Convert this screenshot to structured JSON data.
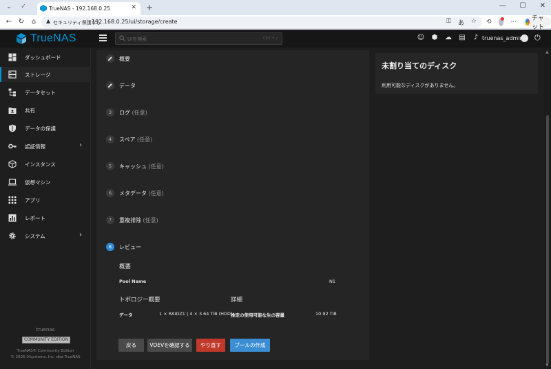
{
  "browser": {
    "tab_title": "TrueNAS - 192.168.0.25",
    "tab_close": "✕",
    "new_tab": "+",
    "security_label": "セキュリティ保護なし",
    "url": "192.168.0.25/ui/storage/create",
    "chat_label": "チャット",
    "controls": {
      "minimize": "—",
      "maximize": "☐",
      "close": "✕"
    }
  },
  "app": {
    "brand": "TrueNAS",
    "search_placeholder": "UIを検索",
    "search_shortcut": "Ctrl + /",
    "username": "truenas_admin"
  },
  "sidebar": {
    "items": [
      {
        "label": "ダッシュボード",
        "icon": "dashboard-icon"
      },
      {
        "label": "ストレージ",
        "icon": "storage-icon",
        "active": true
      },
      {
        "label": "データセット",
        "icon": "datasets-icon"
      },
      {
        "label": "共有",
        "icon": "shares-icon"
      },
      {
        "label": "データの保護",
        "icon": "shield-icon"
      },
      {
        "label": "認証情報",
        "icon": "key-icon",
        "chevron": "›"
      },
      {
        "label": "インスタンス",
        "icon": "cube-icon"
      },
      {
        "label": "仮想マシン",
        "icon": "laptop-icon"
      },
      {
        "label": "アプリ",
        "icon": "apps-icon"
      },
      {
        "label": "レポート",
        "icon": "chart-icon"
      },
      {
        "label": "システム",
        "icon": "gear-icon",
        "chevron": "›"
      }
    ],
    "hostname": "truenas",
    "edition": "COMMUNITY EDITION",
    "legal_line1": "TrueNAS® Community Edition",
    "legal_line2": "© 2026 iXsystems, Inc. dba TrueNAS"
  },
  "wizard": {
    "steps": [
      {
        "num": "",
        "label": "概要",
        "optional": "",
        "done": true
      },
      {
        "num": "",
        "label": "データ",
        "optional": "",
        "done": true
      },
      {
        "num": "3",
        "label": "ログ",
        "optional": "(任意)"
      },
      {
        "num": "4",
        "label": "スペア",
        "optional": "(任意)"
      },
      {
        "num": "5",
        "label": "キャッシュ",
        "optional": "(任意)"
      },
      {
        "num": "6",
        "label": "メタデータ",
        "optional": "(任意)"
      },
      {
        "num": "7",
        "label": "重複排除",
        "optional": "(任意)"
      },
      {
        "num": "8",
        "label": "レビュー",
        "optional": "",
        "active": true
      }
    ],
    "review": {
      "summary_heading": "概要",
      "pool_name_label": "Pool Name",
      "pool_name_value": "N1",
      "topology_heading": "トポロジー概要",
      "details_heading": "詳細",
      "data_label": "データ",
      "data_value": "1 × RAIDZ1 | 4 × 3.64 TiB (HDD)",
      "capacity_label": "推定の使用可能な生の容量",
      "capacity_value": "10.92 TiB"
    },
    "buttons": {
      "back": "戻る",
      "inspect": "VDEVを確認する",
      "reset": "やり直す",
      "create": "プールの作成"
    }
  },
  "unassigned": {
    "title": "未割り当てのディスク",
    "text": "利用可能なディスクがありません。"
  },
  "colors": {
    "brand": "#0095d5",
    "active_step": "#2e8bd8",
    "reset_button": "#c0392b",
    "create_button": "#3b8ed3"
  }
}
